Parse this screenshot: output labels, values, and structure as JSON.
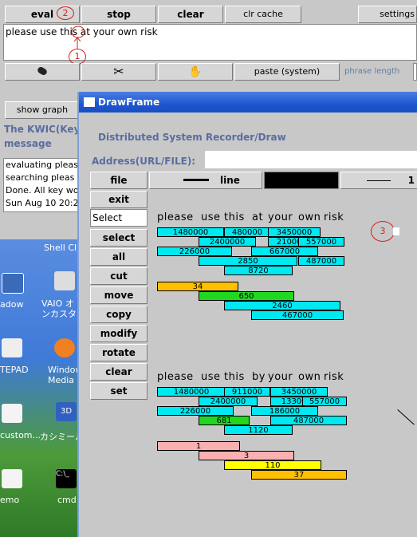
{
  "toolbar": {
    "eval": "eval",
    "stop": "stop",
    "clear": "clear",
    "clr_cache": "clr cache",
    "settings": "settings"
  },
  "input_text": "please use this at your own risk",
  "second_row": {
    "paste": "paste (system)",
    "phrase_length": "phrase length"
  },
  "show_graph": "show graph",
  "kwic_title": "The KWIC(Keyword",
  "kwic_sub": "message",
  "log_lines": [
    "evaluating pleas",
    "searching pleas",
    "Done. All key wo",
    "Sun Aug 10 20:2"
  ],
  "annotations": [
    "1",
    "2",
    "3"
  ],
  "desktop": [
    {
      "label": "Shell Cl",
      "icon": "shell-icon"
    },
    {
      "label": "adow",
      "icon": "window-icon"
    },
    {
      "label": "VAIO オ\nンカスタマ",
      "icon": "vaio-icon"
    },
    {
      "label": "TEPAD",
      "icon": "notepad-icon"
    },
    {
      "label": "Window\nMedia Pl",
      "icon": "media-icon"
    },
    {
      "label": "custom...",
      "icon": "doc-icon"
    },
    {
      "label": "カシミール",
      "icon": "3d-icon"
    },
    {
      "label": "emo",
      "icon": "doc-icon"
    },
    {
      "label": "cmd",
      "icon": "cmd-icon"
    }
  ],
  "drawframe": {
    "title": "DrawFrame",
    "header": "Distributed System Recorder/Draw",
    "address_label": "Address(URL/FILE):",
    "file": "file",
    "line_label": "line",
    "line_width": "1",
    "tools": [
      "exit",
      "Select",
      "select",
      "all",
      "cut",
      "move",
      "copy",
      "modify",
      "rotate",
      "clear",
      "set"
    ],
    "phrase1": [
      "please",
      "use",
      "this",
      "at",
      "your",
      "own",
      "risk"
    ],
    "phrase2": [
      "please",
      "use",
      "this",
      "by",
      "your",
      "own",
      "risk"
    ],
    "bars1": [
      {
        "v": "1480000",
        "c": "#00e8f0"
      },
      {
        "v": "480000",
        "c": "#00e8f0"
      },
      {
        "v": "3450000",
        "c": "#00e8f0"
      },
      {
        "v": "2400000",
        "c": "#00e8f0"
      },
      {
        "v": "2100000",
        "c": "#00e8f0"
      },
      {
        "v": "557000",
        "c": "#00e8f0"
      },
      {
        "v": "226000",
        "c": "#00e8f0"
      },
      {
        "v": "667000",
        "c": "#00e8f0"
      },
      {
        "v": "2850",
        "c": "#00e8f0"
      },
      {
        "v": "487000",
        "c": "#00e8f0"
      },
      {
        "v": "8720",
        "c": "#00e8f0"
      },
      {
        "v": "34",
        "c": "#ffc000"
      },
      {
        "v": "650",
        "c": "#20d820"
      },
      {
        "v": "2460",
        "c": "#00e8f0"
      },
      {
        "v": "467000",
        "c": "#00e8f0"
      }
    ],
    "bars2": [
      {
        "v": "1480000",
        "c": "#00e8f0"
      },
      {
        "v": "911000",
        "c": "#00e8f0"
      },
      {
        "v": "3450000",
        "c": "#00e8f0"
      },
      {
        "v": "2400000",
        "c": "#00e8f0"
      },
      {
        "v": "1330000",
        "c": "#00e8f0"
      },
      {
        "v": "557000",
        "c": "#00e8f0"
      },
      {
        "v": "226000",
        "c": "#00e8f0"
      },
      {
        "v": "186000",
        "c": "#00e8f0"
      },
      {
        "v": "681",
        "c": "#20d820"
      },
      {
        "v": "487000",
        "c": "#00e8f0"
      },
      {
        "v": "1120",
        "c": "#00e8f0"
      },
      {
        "v": "1",
        "c": "#f8b0b0"
      },
      {
        "v": "3",
        "c": "#f8b0b0"
      },
      {
        "v": "110",
        "c": "#ffff00"
      },
      {
        "v": "37",
        "c": "#ffc000"
      }
    ]
  }
}
